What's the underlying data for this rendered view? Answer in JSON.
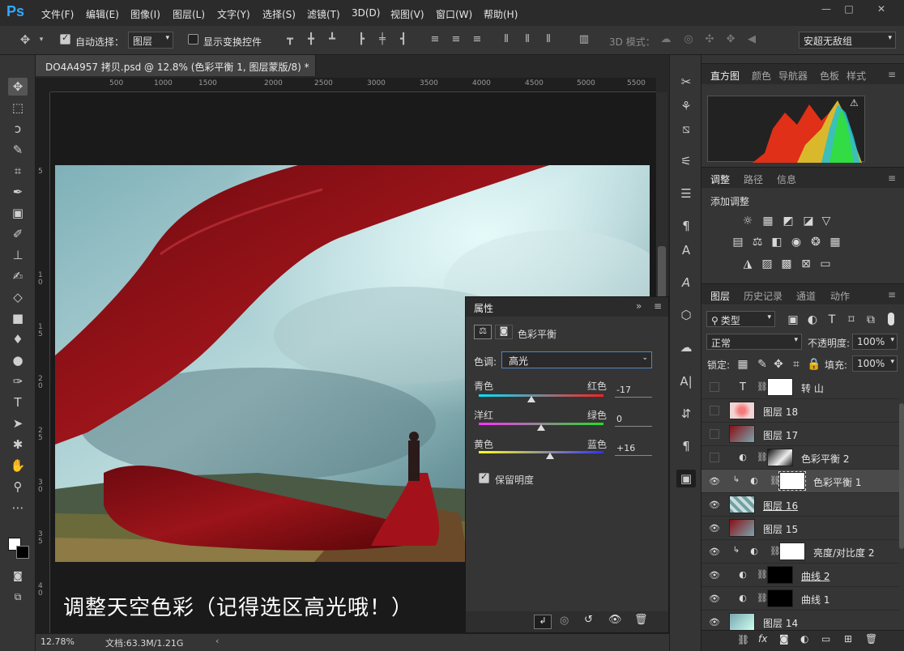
{
  "app": {
    "logo": "Ps"
  },
  "menu": [
    "文件(F)",
    "编辑(E)",
    "图像(I)",
    "图层(L)",
    "文字(Y)",
    "选择(S)",
    "滤镜(T)",
    "3D(D)",
    "视图(V)",
    "窗口(W)",
    "帮助(H)"
  ],
  "window_controls": {
    "minimize": "—",
    "restore": "□",
    "close": "✕"
  },
  "options": {
    "auto_select_label": "自动选择：",
    "auto_select_checked": true,
    "auto_select_value": "图层",
    "show_transform_label": "显示变换控件",
    "mode_3d_label": "3D 模式：",
    "workspace": "安超无敌组"
  },
  "document": {
    "tab_title": "DO4A4957 拷贝.psd @ 12.8% (色彩平衡 1, 图层蒙版/8) *",
    "ruler_top": [
      "500",
      "1000",
      "1500",
      "2000",
      "2500",
      "3000",
      "3500",
      "4000",
      "4500",
      "5000",
      "5500"
    ],
    "ruler_left": [
      "5",
      "1 0",
      "1 5",
      "2 0",
      "2 5",
      "3 0",
      "3 5",
      "4 0"
    ],
    "caption": "调整天空色彩（记得选区高光哦！）",
    "zoom": "12.78%",
    "doc_size": "文档:63.3M/1.21G"
  },
  "properties": {
    "title": "属性",
    "adjustment_name": "色彩平衡",
    "tone_label": "色调:",
    "tone_value": "高光",
    "sliders": [
      {
        "left": "青色",
        "right": "红色",
        "value": "-17",
        "fraction": 0.42
      },
      {
        "left": "洋红",
        "right": "绿色",
        "value": "0",
        "fraction": 0.5
      },
      {
        "left": "黄色",
        "right": "蓝色",
        "value": "+16",
        "fraction": 0.57
      }
    ],
    "preserve_luminosity_label": "保留明度",
    "preserve_luminosity_checked": true
  },
  "panels": {
    "top_tabs": [
      "直方图",
      "颜色",
      "导航器",
      "色板",
      "样式"
    ],
    "adj_tabs": [
      "调整",
      "路径",
      "信息"
    ],
    "adj_title": "添加调整",
    "layer_tabs": [
      "图层",
      "历史记录",
      "通道",
      "动作"
    ],
    "filter_kind": "类型",
    "blend_mode": "正常",
    "opacity_label": "不透明度:",
    "opacity": "100%",
    "lock_label": "锁定:",
    "fill_label": "填充:",
    "fill": "100%"
  },
  "layers": [
    {
      "name": "转 山",
      "visible": false,
      "kind": "text"
    },
    {
      "name": "图层 18",
      "visible": false,
      "kind": "pixel"
    },
    {
      "name": "图层 17",
      "visible": false,
      "kind": "pixel"
    },
    {
      "name": "色彩平衡 2",
      "visible": false,
      "kind": "adj"
    },
    {
      "name": "色彩平衡 1",
      "visible": true,
      "kind": "adj",
      "selected": true
    },
    {
      "name": "图层 16",
      "visible": true,
      "kind": "pixel"
    },
    {
      "name": "图层 15",
      "visible": true,
      "kind": "pixel"
    },
    {
      "name": "亮度/对比度 2",
      "visible": true,
      "kind": "adj"
    },
    {
      "name": "曲线 2",
      "visible": true,
      "kind": "adj"
    },
    {
      "name": "曲线 1",
      "visible": true,
      "kind": "adj"
    },
    {
      "name": "图层 14",
      "visible": true,
      "kind": "pixel"
    }
  ],
  "colors": {
    "accent": "#31a8ff",
    "cloth": "#8a0f14"
  }
}
